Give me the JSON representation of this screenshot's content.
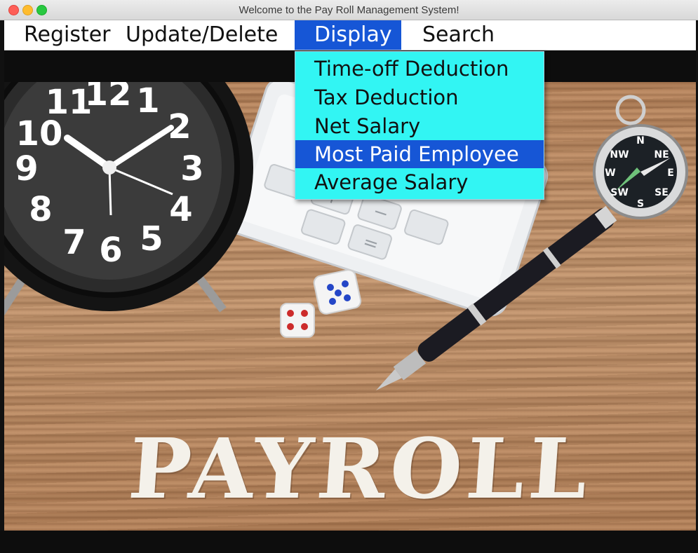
{
  "window": {
    "title": "Welcome to the Pay Roll Management System!"
  },
  "menubar": {
    "items": [
      {
        "label": "Register"
      },
      {
        "label": "Update/Delete"
      },
      {
        "label": "Display"
      },
      {
        "label": "Search"
      }
    ],
    "active": "Display"
  },
  "dropdown": {
    "items": [
      {
        "label": "Time-off Deduction"
      },
      {
        "label": "Tax Deduction"
      },
      {
        "label": "Net Salary"
      },
      {
        "label": "Most Paid Employee"
      },
      {
        "label": "Average Salary"
      }
    ],
    "highlighted": "Most Paid Employee"
  },
  "image": {
    "text": "PAYROLL",
    "clock_numerals": [
      "12",
      "1",
      "2",
      "3",
      "4",
      "5",
      "6",
      "7",
      "8",
      "9",
      "10",
      "11"
    ],
    "compass_letters": [
      "N",
      "NE",
      "E",
      "SE",
      "S",
      "SW",
      "W",
      "NW"
    ]
  },
  "colors": {
    "accent": "#1656d6",
    "menu_popup": "#32f5f3",
    "menubar_bg": "#ffffff"
  }
}
